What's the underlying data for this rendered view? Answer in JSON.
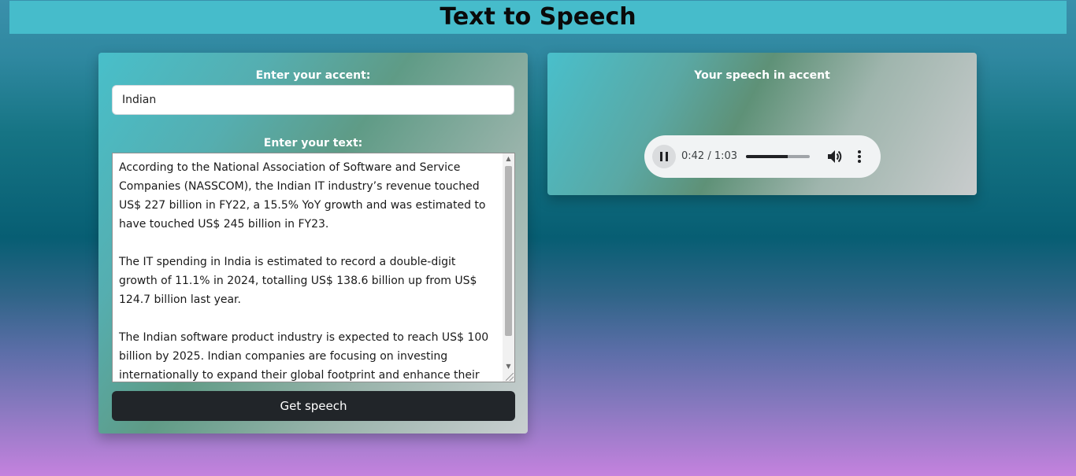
{
  "header": {
    "title": "Text to Speech"
  },
  "form": {
    "accent_label": "Enter your accent:",
    "accent_value": "Indian",
    "text_label": "Enter your text:",
    "text_value": "According to the National Association of Software and Service Companies (NASSCOM), the Indian IT industry’s revenue touched US$ 227 billion in FY22, a 15.5% YoY growth and was estimated to have touched US$ 245 billion in FY23.\n\nThe IT spending in India is estimated to record a double-digit growth of 11.1% in 2024, totalling US$ 138.6 billion up from US$ 124.7 billion last year.\n\nThe Indian software product industry is expected to reach US$ 100 billion by 2025. Indian companies are focusing on investing internationally to expand their global footprint and enhance their",
    "submit_label": "Get speech"
  },
  "output": {
    "title": "Your speech in accent",
    "player": {
      "time": "0:42 / 1:03",
      "progress": 0.65,
      "state": "playing",
      "icons": {
        "pause": "pause-icon",
        "volume": "volume-icon",
        "more": "more-vert-icon"
      }
    }
  },
  "colors": {
    "header_bg": "#46bccb",
    "button_bg": "#212529",
    "bg_top": "#3a90ab",
    "bg_bottom": "#c482de"
  }
}
